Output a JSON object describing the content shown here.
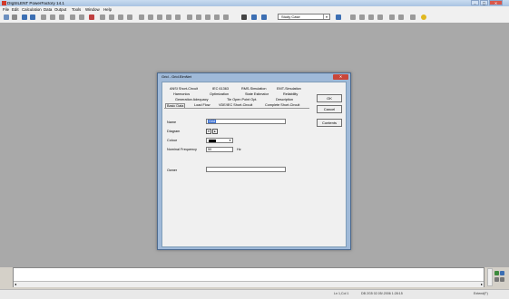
{
  "window": {
    "title": "DIgSILENT PowerFactory 14.1"
  },
  "menu": [
    "File",
    "Edit",
    "Calculation",
    "Data",
    "Output",
    "Tools",
    "Window",
    "Help"
  ],
  "toolbar": {
    "study_case": "Study Case"
  },
  "colors": {
    "titlebar": "#b7cfea",
    "workspace": "#a9a9a9",
    "dialog_frame": "#9fb9d8",
    "close": "#c9463a",
    "toolbar": "#f0f0f0",
    "colour_swatch": "#000000"
  },
  "dialog": {
    "title": "Grid - Grid.ElmNet",
    "tabs_row1": [
      "ANSI Short-Circuit",
      "IEC 61363",
      "RMS-Simulation",
      "EMT-Simulation"
    ],
    "tabs_row2": [
      "Harmonics",
      "Optimization",
      "State Estimator",
      "Reliability"
    ],
    "tabs_row3": [
      "Generation Adequacy",
      "Tie Open Point Opt.",
      "Description"
    ],
    "tabs_row4": [
      "Basic Data",
      "Load Flow",
      "VDE/IEC Short-Circuit",
      "Complete Short-Circuit"
    ],
    "buttons": {
      "ok": "OK",
      "cancel": "Cancel",
      "contents": "Contents"
    },
    "fields": {
      "name_label": "Name",
      "name_value": "Grid",
      "diagram_label": "Diagram",
      "colour_label": "Colour",
      "freq_label": "Nominal Frequency",
      "freq_value": "50",
      "freq_unit": "Hz",
      "owner_label": "Owner",
      "owner_value": ""
    }
  },
  "status": {
    "position": "Ln 1,Col 1",
    "datetime": "DB 2G5  02.05/.2006 1:28:15",
    "mode": "Extend(F)"
  }
}
